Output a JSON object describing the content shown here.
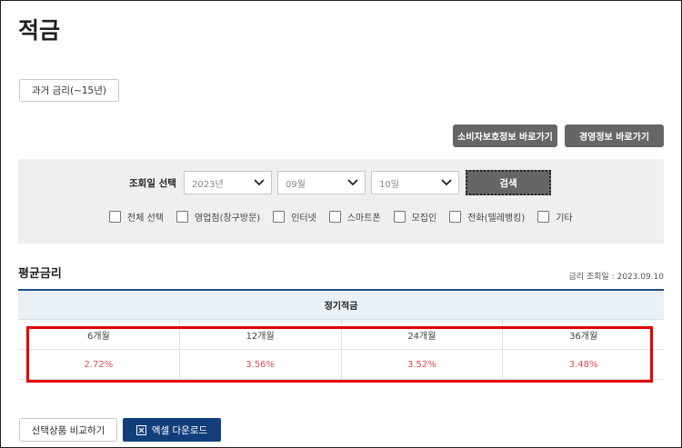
{
  "page": {
    "title": "적금"
  },
  "buttons": {
    "past_rates": "과거 금리(~15년)",
    "consumer_info": "소비자보호정보 바로가기",
    "management_info": "경영정보 바로가기",
    "compare": "선택상품 비교하기",
    "excel": "엑셀 다운로드"
  },
  "search": {
    "label": "조회일 선택",
    "year": "2023년",
    "month": "09월",
    "day": "10일",
    "button": "검색",
    "channels": [
      {
        "label": "전체 선택",
        "checked": false
      },
      {
        "label": "영업점(창구방문)",
        "checked": false
      },
      {
        "label": "인터넷",
        "checked": false
      },
      {
        "label": "스마트폰",
        "checked": false
      },
      {
        "label": "모집인",
        "checked": false
      },
      {
        "label": "전화(텔레뱅킹)",
        "checked": false
      },
      {
        "label": "기타",
        "checked": false
      }
    ]
  },
  "average": {
    "heading": "평균금리",
    "query_date": "금리 조회일 : 2023.09.10",
    "table_header": "정기적금",
    "terms": [
      "6개월",
      "12개월",
      "24개월",
      "36개월"
    ],
    "rates": [
      "2.72%",
      "3.56%",
      "3.52%",
      "3.48%"
    ]
  },
  "colors": {
    "accent": "#123f7c",
    "rate": "#e34a4a",
    "highlight": "#e00000"
  }
}
